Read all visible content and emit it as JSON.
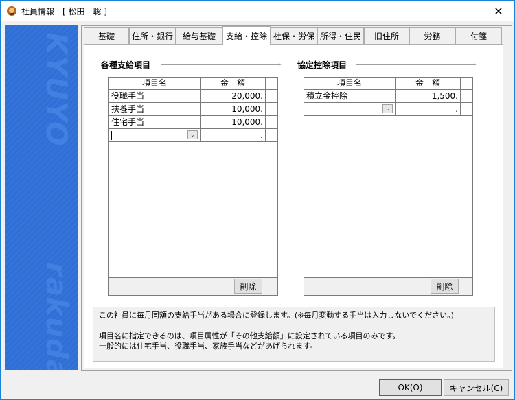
{
  "window": {
    "title": "社員情報 - [ 松田　聡 ]",
    "close_glyph": "✕"
  },
  "sidebar": {
    "word1": "KYUYO",
    "word2": "rakuda"
  },
  "tabs": [
    {
      "label": "基礎"
    },
    {
      "label": "住所・銀行"
    },
    {
      "label": "給与基礎"
    },
    {
      "label": "支給・控除"
    },
    {
      "label": "社保・労保"
    },
    {
      "label": "所得・住民"
    },
    {
      "label": "旧住所"
    },
    {
      "label": "労務"
    },
    {
      "label": "付箋"
    }
  ],
  "active_tab": "支給・控除",
  "payments": {
    "title": "各種支給項目",
    "headers": [
      "項目名",
      "金　額"
    ],
    "rows": [
      {
        "name": "役職手当",
        "amount": "20,000."
      },
      {
        "name": "扶養手当",
        "amount": "10,000."
      },
      {
        "name": "住宅手当",
        "amount": "10,000."
      }
    ],
    "blank_amount": ".",
    "delete_label": "削除"
  },
  "deductions": {
    "title": "協定控除項目",
    "headers": [
      "項目名",
      "金　額"
    ],
    "rows": [
      {
        "name": "積立金控除",
        "amount": "1,500."
      }
    ],
    "blank_amount": ".",
    "delete_label": "削除"
  },
  "info": {
    "line1": "この社員に毎月同額の支給手当がある場合に登録します。(※毎月変動する手当は入力しないでください。)",
    "line2": "項目名に指定できるのは、項目属性が「その他支給額」に設定されている項目のみです。",
    "line3": "一般的には住宅手当、役職手当、家族手当などがあげられます。"
  },
  "footer": {
    "ok_label": "OK(O)",
    "cancel_label": "キャンセル(C)"
  },
  "colors": {
    "accent": "#0078d7",
    "sidebar": "#2f6fd6"
  }
}
